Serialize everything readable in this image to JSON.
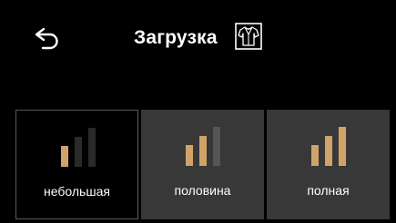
{
  "header": {
    "title": "Загрузка",
    "back_icon": "back-arrow-icon",
    "mode_icon": "shirt-icon"
  },
  "colors": {
    "active_bar": "#d1a369",
    "inactive_bar_dark": "#2a2a2a",
    "inactive_bar_mid": "#555555",
    "tile_bg": "#383838"
  },
  "load_options": [
    {
      "label": "небольшая",
      "level": 1,
      "of": 3,
      "selected": true
    },
    {
      "label": "половина",
      "level": 2,
      "of": 3,
      "selected": false
    },
    {
      "label": "полная",
      "level": 3,
      "of": 3,
      "selected": false
    }
  ]
}
